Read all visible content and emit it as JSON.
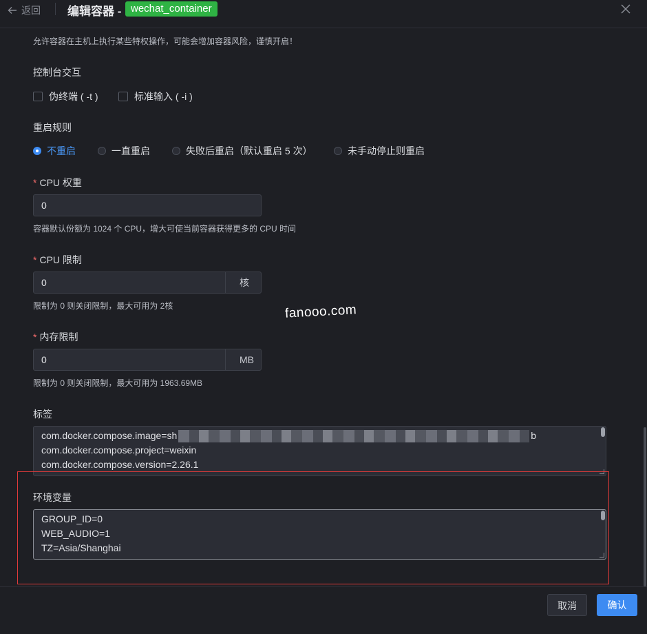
{
  "header": {
    "back_label": "返回",
    "title": "编辑容器 -",
    "container_name": "wechat_container"
  },
  "privileged_hint": "允许容器在主机上执行某些特权操作，可能会增加容器风险，谨慎开启！",
  "console": {
    "label": "控制台交互",
    "tty_label": "伪终端 ( -t )",
    "stdin_label": "标准输入 ( -i )"
  },
  "restart": {
    "label": "重启规则",
    "options": [
      "不重启",
      "一直重启",
      "失败后重启（默认重启 5 次）",
      "未手动停止则重启"
    ],
    "selected": "不重启"
  },
  "cpu_weight": {
    "label": "CPU 权重",
    "value": "0",
    "hint": "容器默认份额为 1024 个 CPU，增大可使当前容器获得更多的 CPU 时间"
  },
  "cpu_limit": {
    "label": "CPU 限制",
    "value": "0",
    "unit": "核",
    "hint": "限制为 0 则关闭限制，最大可用为 2核"
  },
  "memory_limit": {
    "label": "内存限制",
    "value": "0",
    "unit": "MB",
    "hint": "限制为 0 则关闭限制，最大可用为 1963.69MB"
  },
  "labels": {
    "label": "标签",
    "line1_prefix": "com.docker.compose.image=sh",
    "line1_suffix": "b",
    "line2": "com.docker.compose.project=weixin",
    "line3": "com.docker.compose.version=2.26.1"
  },
  "env": {
    "label": "环境变量",
    "lines": [
      "GROUP_ID=0",
      "WEB_AUDIO=1",
      "TZ=Asia/Shanghai"
    ]
  },
  "watermark": "fanooo.com",
  "footer": {
    "cancel_label": "取消",
    "confirm_label": "确认"
  },
  "colors": {
    "accent": "#3d8bf2",
    "tag_green": "#2fb344",
    "required_red": "#f56c6c",
    "highlight_box": "#e03a3a"
  }
}
